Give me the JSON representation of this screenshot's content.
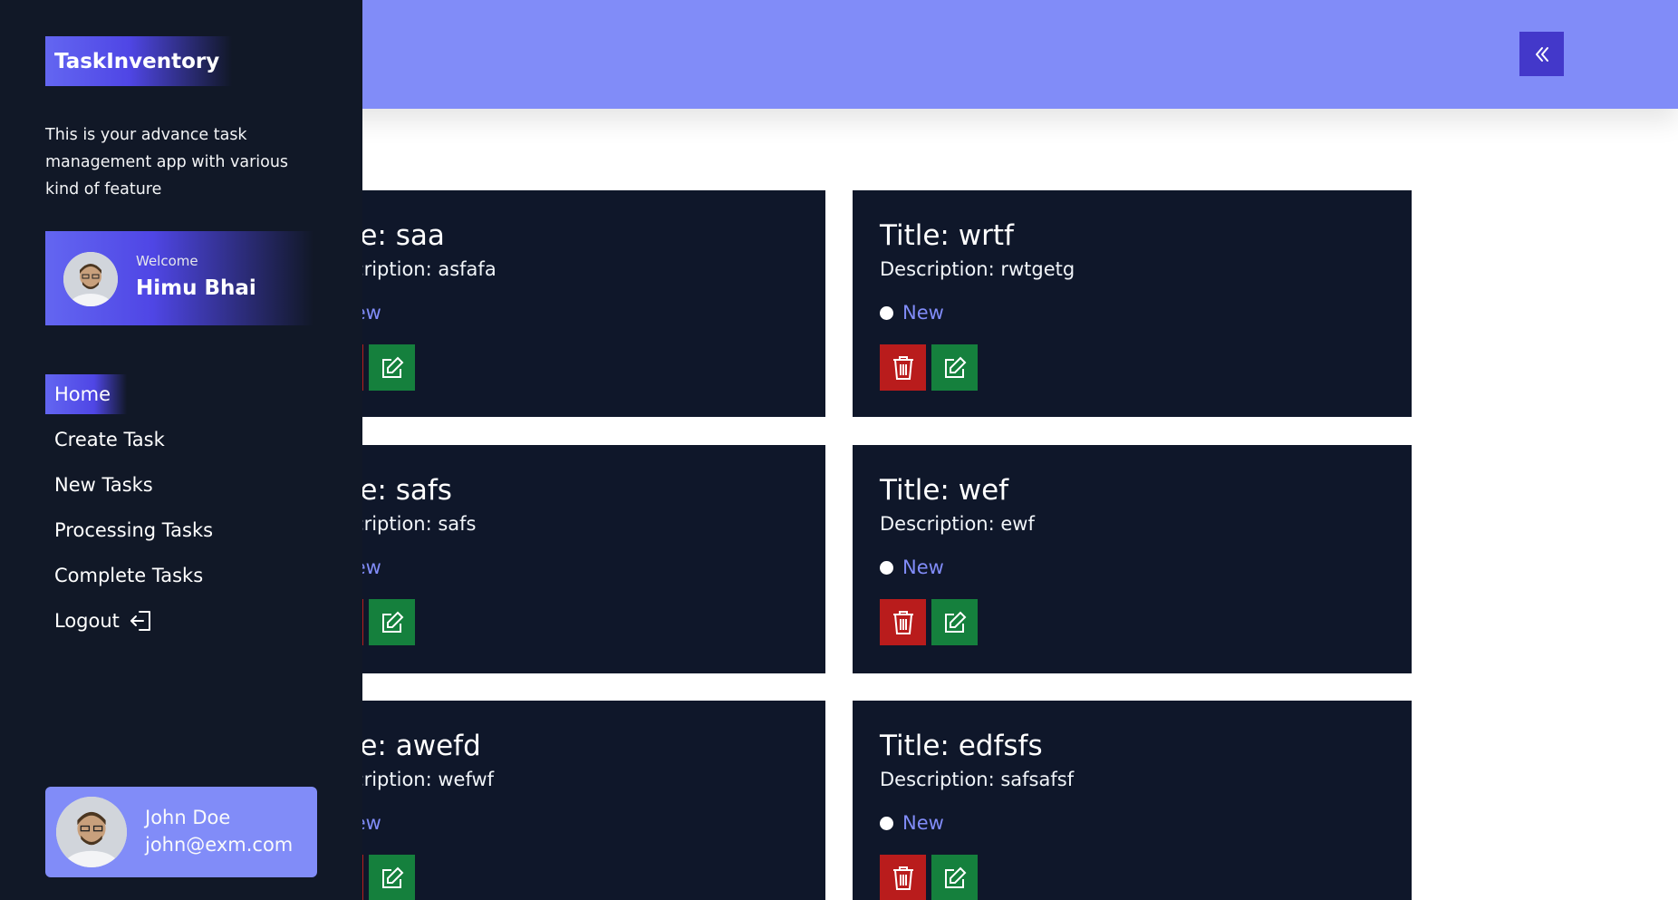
{
  "app": {
    "brand": "TaskInventory",
    "tagline": "This is your advance task management app with various kind of feature"
  },
  "welcome": {
    "label": "Welcome",
    "name": "Himu Bhai"
  },
  "nav": [
    {
      "label": "Home",
      "active": true
    },
    {
      "label": "Create Task",
      "active": false
    },
    {
      "label": "New Tasks",
      "active": false
    },
    {
      "label": "Processing Tasks",
      "active": false
    },
    {
      "label": "Complete Tasks",
      "active": false
    },
    {
      "label": "Logout",
      "active": false,
      "icon": "logout-icon"
    }
  ],
  "user": {
    "name": "John Doe",
    "email": "john@exm.com"
  },
  "header": {
    "collapse_icon": "double-chevron-left-icon"
  },
  "tasks": [
    {
      "title": "Title: saa",
      "description": "Description: asfafa",
      "status": "New"
    },
    {
      "title": "Title: wrtf",
      "description": "Description: rwtgetg",
      "status": "New"
    },
    {
      "title": "Title: safs",
      "description": "Description: safs",
      "status": "New"
    },
    {
      "title": "Title: wef",
      "description": "Description: ewf",
      "status": "New"
    },
    {
      "title": "Title: awefd",
      "description": "Description: wefwf",
      "status": "New"
    },
    {
      "title": "Title: edfsfs",
      "description": "Description: safsafsf",
      "status": "New"
    }
  ],
  "colors": {
    "accent": "#818cf8",
    "sidebar_bg": "#111827",
    "card_bg": "#0f172a",
    "delete": "#b91c1c",
    "edit": "#15803d",
    "collapse_button": "#4338ca"
  }
}
